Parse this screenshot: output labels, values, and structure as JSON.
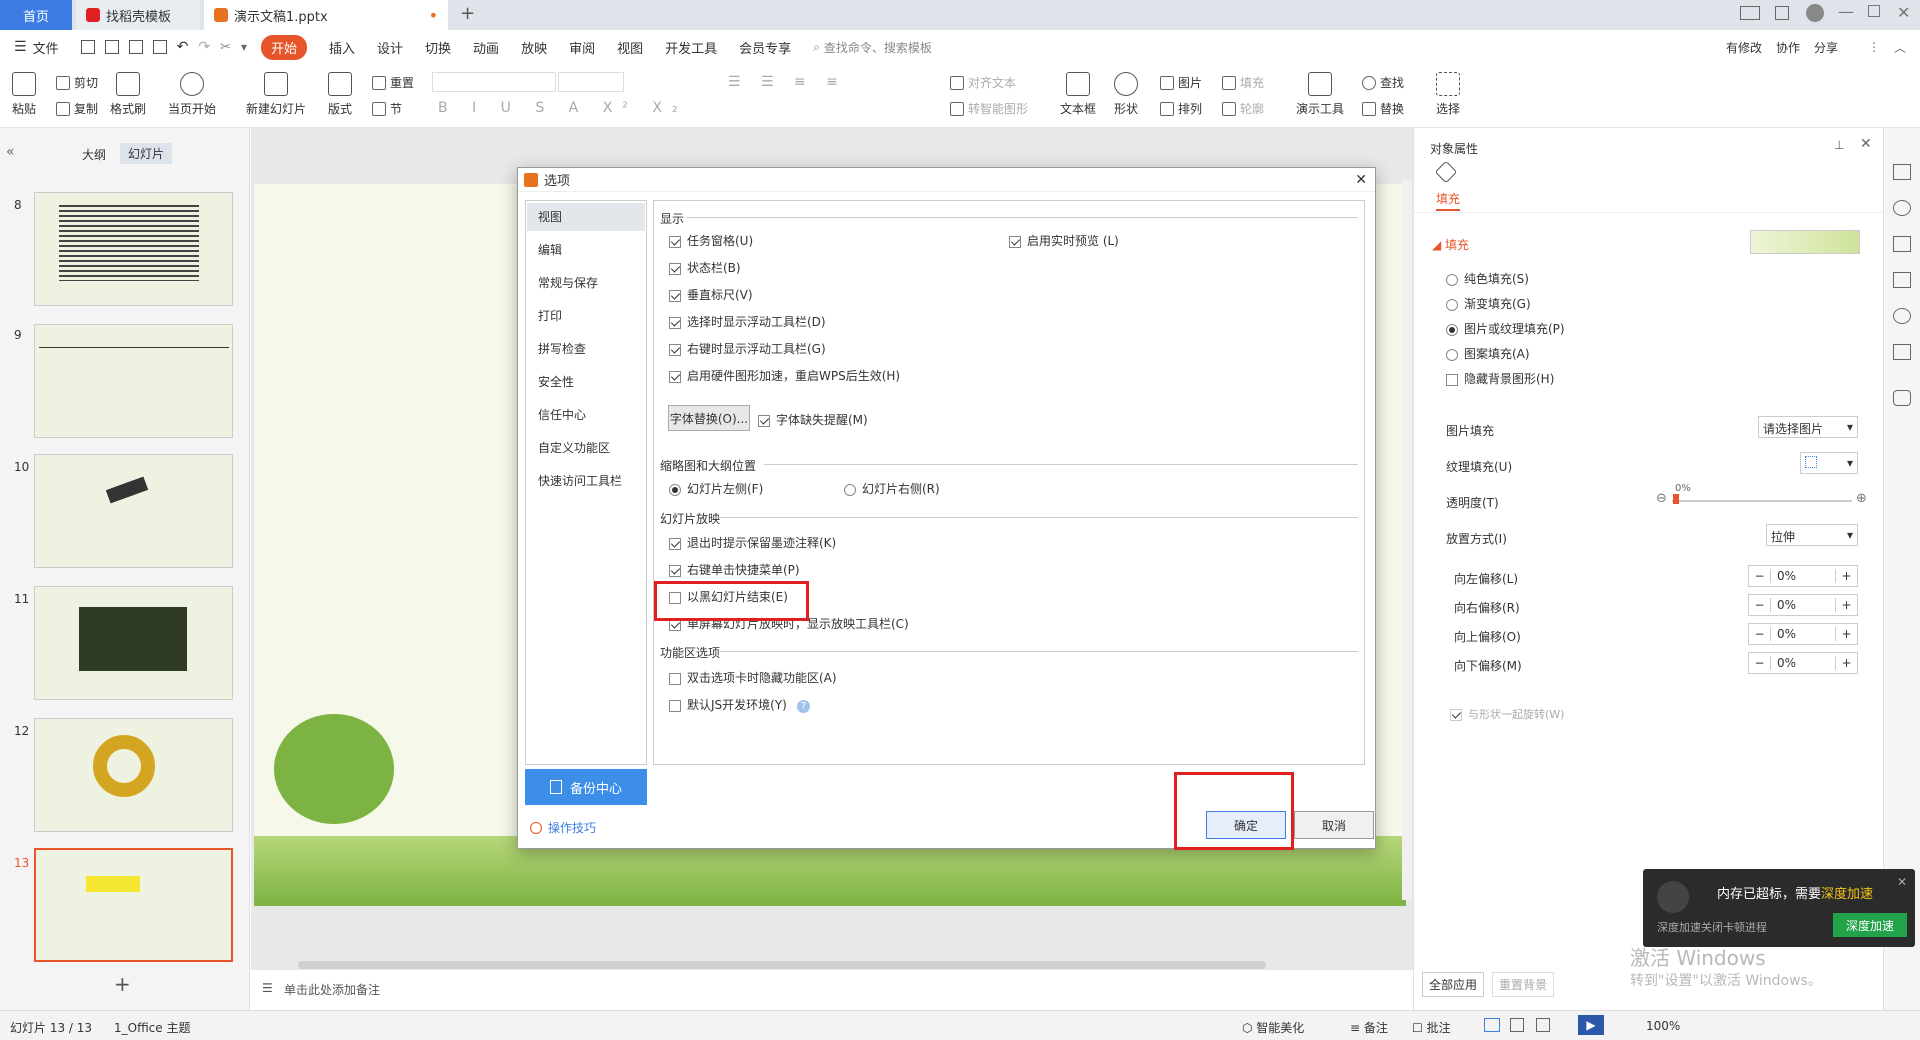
{
  "tabs": {
    "home": "首页",
    "template": "找稻壳模板",
    "document": "演示文稿1.pptx"
  },
  "menubar": {
    "file": "文件",
    "items": [
      "开始",
      "插入",
      "设计",
      "切换",
      "动画",
      "放映",
      "审阅",
      "视图",
      "开发工具",
      "会员专享"
    ],
    "search": "查找命令、搜索模板",
    "right": [
      "有修改",
      "协作",
      "分享"
    ]
  },
  "ribbon": {
    "paste": "粘贴",
    "cut": "剪切",
    "copy": "复制",
    "format_painter": "格式刷",
    "from_start": "当页开始",
    "new_slide": "新建幻灯片",
    "layout": "版式",
    "reset": "重置",
    "section": "节",
    "align_text": "对齐文本",
    "convert_smartart": "转智能图形",
    "textbox": "文本框",
    "shape": "形状",
    "picture": "图片",
    "fill": "填充",
    "arrange": "排列",
    "outline": "轮廓",
    "present_tool": "演示工具",
    "find": "查找",
    "replace": "替换",
    "select": "选择"
  },
  "leftpanel": {
    "outline_tab": "大纲",
    "slides_tab": "幻灯片",
    "slide_numbers": [
      "8",
      "9",
      "10",
      "11",
      "12",
      "13"
    ],
    "add_slide": "+"
  },
  "notes": "单击此处添加备注",
  "rightpanel": {
    "title": "对象属性",
    "fill_tab": "填充",
    "fill_section": "填充",
    "fill_options": [
      "纯色填充(S)",
      "渐变填充(G)",
      "图片或纹理填充(P)",
      "图案填充(A)"
    ],
    "selected_fill": 2,
    "hide_bg": "隐藏背景图形(H)",
    "picture_fill": "图片填充",
    "picture_fill_value": "请选择图片",
    "texture_fill": "纹理填充(U)",
    "transparency": "透明度(T)",
    "transparency_value": "0%",
    "placement": "放置方式(I)",
    "placement_value": "拉伸",
    "offsets": [
      {
        "label": "向左偏移(L)",
        "value": "0%"
      },
      {
        "label": "向右偏移(R)",
        "value": "0%"
      },
      {
        "label": "向上偏移(O)",
        "value": "0%"
      },
      {
        "label": "向下偏移(M)",
        "value": "0%"
      }
    ],
    "rotate_with_shape": "与形状一起旋转(W)",
    "apply_all": "全部应用",
    "reset_bg": "重置背景"
  },
  "statusbar": {
    "slide": "幻灯片 13 / 13",
    "theme": "1_Office 主题",
    "beautify": "智能美化",
    "notes": "备注",
    "comment": "批注",
    "zoom": "100%"
  },
  "dialog": {
    "title": "选项",
    "nav": [
      "视图",
      "编辑",
      "常规与保存",
      "打印",
      "拼写检查",
      "安全性",
      "信任中心",
      "自定义功能区",
      "快速访问工具栏"
    ],
    "selected_nav": 0,
    "section_display": "显示",
    "display_options": [
      {
        "label": "任务窗格(U)",
        "checked": true
      },
      {
        "label": "状态栏(B)",
        "checked": true
      },
      {
        "label": "垂直标尺(V)",
        "checked": true
      },
      {
        "label": "选择时显示浮动工具栏(D)",
        "checked": true
      },
      {
        "label": "右键时显示浮动工具栏(G)",
        "checked": true
      },
      {
        "label": "启用硬件图形加速，重启WPS后生效(H)",
        "checked": true
      }
    ],
    "live_preview": "启用实时预览 (L)",
    "font_replace_btn": "字体替换(O)...",
    "font_missing": "字体缺失提醒(M)",
    "section_thumb": "缩略图和大纲位置",
    "thumb_left": "幻灯片左侧(F)",
    "thumb_right": "幻灯片右侧(R)",
    "section_show": "幻灯片放映",
    "show_options": [
      {
        "label": "退出时提示保留墨迹注释(K)",
        "checked": true
      },
      {
        "label": "右键单击快捷菜单(P)",
        "checked": true
      },
      {
        "label": "以黑幻灯片结束(E)",
        "checked": false
      },
      {
        "label": "单屏幕幻灯片放映时，显示放映工具栏(C)",
        "checked": true
      }
    ],
    "section_ribbon": "功能区选项",
    "ribbon_options": [
      {
        "label": "双击选项卡时隐藏功能区(A)",
        "checked": false
      },
      {
        "label": "默认JS开发环境(Y)",
        "checked": false
      }
    ],
    "backup": "备份中心",
    "tips": "操作技巧",
    "ok": "确定",
    "cancel": "取消"
  },
  "notification": {
    "title": "内存已超标，需要",
    "title_link": "深度加速",
    "subtitle": "深度加速关闭卡顿进程",
    "button": "深度加速"
  },
  "watermark": {
    "line1": "激活 Windows",
    "line2": "转到\"设置\"以激活 Windows。"
  },
  "colors": {
    "accent": "#e8552a",
    "blue": "#3d8ee8",
    "highlight_red": "#e02020"
  }
}
